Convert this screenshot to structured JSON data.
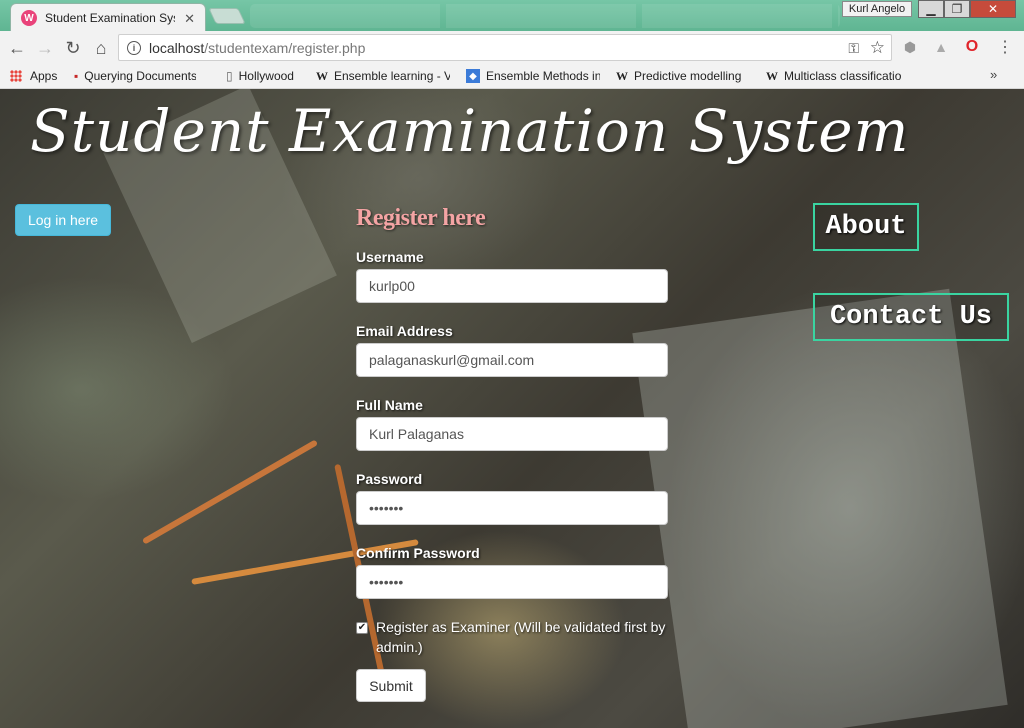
{
  "browser": {
    "tab_title": "Student Examination Sys",
    "tab_favicon": "W",
    "profile_name": "Kurl Angelo",
    "url_host": "localhost",
    "url_path": "/studentexam/register.php",
    "bookmarks": [
      {
        "icon": "apps-icon",
        "label": "Apps"
      },
      {
        "icon": "red-square-icon",
        "label": "Querying Documents"
      },
      {
        "icon": "page-icon",
        "label": "Hollywood"
      },
      {
        "icon": "wikipedia-icon",
        "label": "Ensemble learning - V"
      },
      {
        "icon": "blue-diamond-icon",
        "label": "Ensemble Methods in"
      },
      {
        "icon": "wikipedia-icon",
        "label": "Predictive modelling"
      },
      {
        "icon": "wikipedia-icon",
        "label": "Multiclass classificatio"
      }
    ]
  },
  "header": {
    "site_title": "Student Examination System",
    "login_button": "Log in here",
    "nav_about": "About",
    "nav_contact": "Contact Us"
  },
  "form": {
    "title": "Register here",
    "username_label": "Username",
    "username_value": "kurlp00",
    "email_label": "Email Address",
    "email_value": "palaganaskurl@gmail.com",
    "fullname_label": "Full Name",
    "fullname_value": "Kurl Palaganas",
    "password_label": "Password",
    "password_value": "•••••••",
    "confirm_label": "Confirm Password",
    "confirm_value": "•••••••",
    "examiner_checked": true,
    "examiner_label": "Register as Examiner (Will be validated first by admin.)",
    "submit_label": "Submit"
  }
}
